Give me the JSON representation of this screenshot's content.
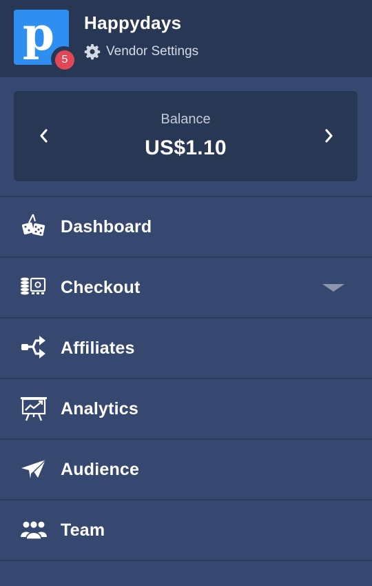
{
  "header": {
    "logo_letter": "p",
    "notification_count": "5",
    "vendor_name": "Happydays",
    "settings_label": "Vendor Settings"
  },
  "balance": {
    "label": "Balance",
    "value": "US$1.10"
  },
  "menu": {
    "items": [
      {
        "label": "Dashboard",
        "icon": "dice-icon"
      },
      {
        "label": "Checkout",
        "icon": "cash-register-icon",
        "has_dropdown": true
      },
      {
        "label": "Affiliates",
        "icon": "share-arrows-icon"
      },
      {
        "label": "Analytics",
        "icon": "presentation-chart-icon"
      },
      {
        "label": "Audience",
        "icon": "paper-plane-icon"
      },
      {
        "label": "Team",
        "icon": "users-icon"
      }
    ]
  },
  "colors": {
    "background": "#364870",
    "header": "#283754",
    "logo": "#2f8ff0",
    "badge": "#e04857"
  }
}
